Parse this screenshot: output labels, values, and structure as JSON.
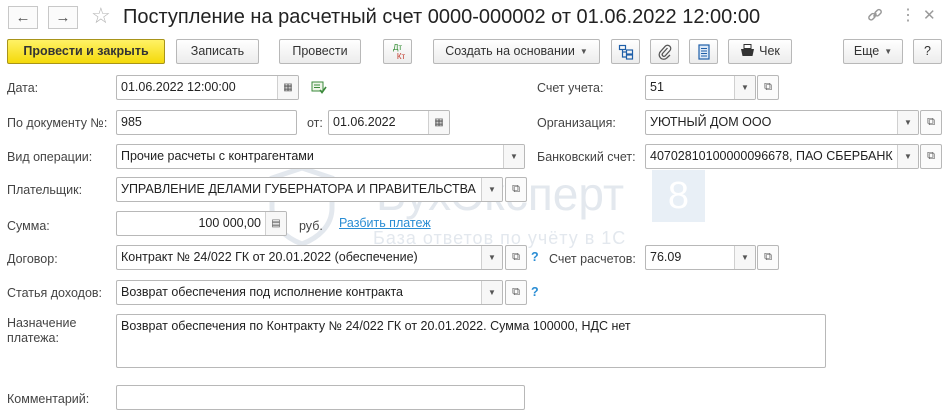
{
  "window": {
    "title": "Поступление на расчетный счет 0000-000002 от 01.06.2022 12:00:00",
    "back_icon": "arrow-left-icon",
    "forward_icon": "arrow-right-icon",
    "favorite_icon": "star-icon",
    "link_icon": "link-icon",
    "menu_icon": "more-vertical-icon",
    "close_icon": "close-icon"
  },
  "toolbar": {
    "post_close_label": "Провести и закрыть",
    "save_label": "Записать",
    "post_label": "Провести",
    "dtkt_dt": "Дт",
    "dtkt_kt": "Кт",
    "create_based_label": "Создать на основании",
    "check_label": "Чек",
    "more_label": "Еще",
    "help_label": "?"
  },
  "form": {
    "date": {
      "label": "Дата:",
      "value": "01.06.2022 12:00:00"
    },
    "doc_number": {
      "label": "По документу №:",
      "value": "985"
    },
    "doc_date": {
      "label": "от:",
      "value": "01.06.2022"
    },
    "operation_type": {
      "label": "Вид операции:",
      "value": "Прочие расчеты с контрагентами"
    },
    "payer": {
      "label": "Плательщик:",
      "value": "УПРАВЛЕНИЕ ДЕЛАМИ ГУБЕРНАТОРА И ПРАВИТЕЛЬСТВА"
    },
    "amount": {
      "label": "Сумма:",
      "value": "100 000,00",
      "currency": "руб.",
      "split_link": "Разбить платеж"
    },
    "contract": {
      "label": "Договор:",
      "value": "Контракт № 24/022 ГК от 20.01.2022 (обеспечение)"
    },
    "income_item": {
      "label": "Статья доходов:",
      "value": "Возврат обеспечения под исполнение контракта"
    },
    "purpose": {
      "label_line1": "Назначение",
      "label_line2": "платежа:",
      "value": "Возврат обеспечения по Контракту № 24/022 ГК от 20.01.2022. Сумма 100000, НДС нет"
    },
    "comment": {
      "label": "Комментарий:",
      "value": ""
    },
    "account": {
      "label": "Счет учета:",
      "value": "51"
    },
    "organization": {
      "label": "Организация:",
      "value": "УЮТНЫЙ ДОМ ООО"
    },
    "bank_account": {
      "label": "Банковский счет:",
      "value": "40702810100000096678, ПАО СБЕРБАНК"
    },
    "settlement_account": {
      "label": "Счет расчетов:",
      "value": "76.09"
    },
    "help_mark": "?"
  },
  "watermark": {
    "brand": "БухЭксперт",
    "digit": "8",
    "tagline": "База ответов по учёту в 1С"
  }
}
